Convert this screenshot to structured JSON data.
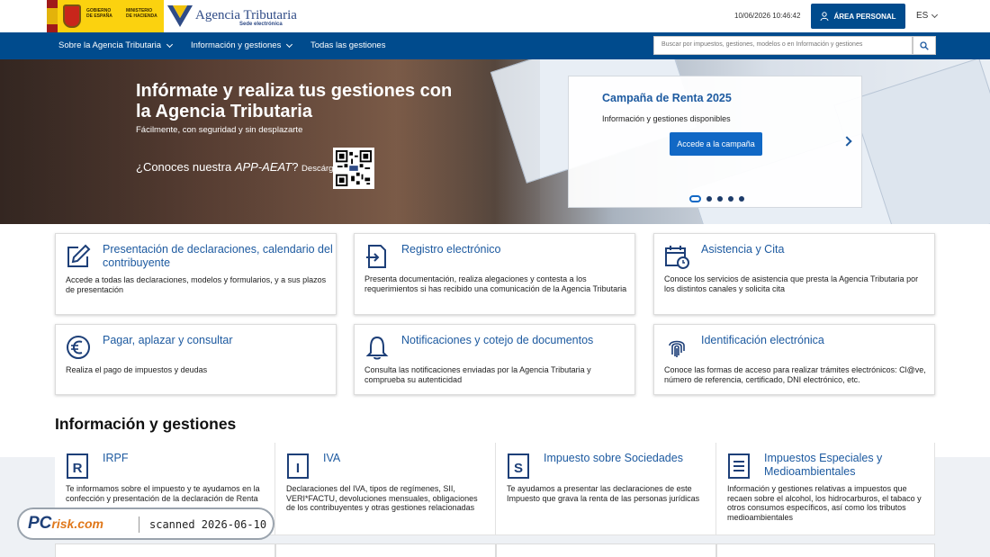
{
  "header": {
    "gov_line1": "GOBIERNO DE ESPAÑA",
    "gov_line2": "MINISTERIO DE HACIENDA",
    "agency_name": "Agencia Tributaria",
    "agency_sub": "Sede electrónica",
    "datetime": "10/06/2026 10:46:42",
    "area_personal": "ÁREA PERSONAL",
    "lang": "ES"
  },
  "nav": {
    "items": [
      "Sobre la Agencia Tributaria",
      "Información y gestiones",
      "Todas las gestiones"
    ],
    "search_placeholder": "Buscar por impuestos, gestiones, modelos o en Información y gestiones"
  },
  "hero": {
    "title": "Infórmate y realiza tus gestiones con la Agencia Tributaria",
    "subtitle": "Fácilmente, con seguridad y sin desplazarte",
    "app_question_pre": "¿Conoces nuestra ",
    "app_name": "APP-AEAT",
    "app_question_post": "?",
    "app_download": "Descárgala",
    "promo_title": "Campaña de Renta 2025",
    "promo_sub": "Información y gestiones disponibles",
    "promo_button": "Accede a la campaña",
    "slides_total": 5,
    "slide_active": 1
  },
  "cards": [
    {
      "title": "Presentación de declaraciones, calendario del contribuyente",
      "desc": "Accede a todas las declaraciones, modelos y formularios, y a sus plazos de presentación",
      "icon": "edit-icon"
    },
    {
      "title": "Registro electrónico",
      "desc": "Presenta documentación, realiza alegaciones y contesta a los requerimientos si has recibido una comunicación de la Agencia Tributaria",
      "icon": "document-arrow-icon"
    },
    {
      "title": "Asistencia y Cita",
      "desc": "Conoce los servicios de asistencia que presta la Agencia Tributaria por los distintos canales y solicita cita",
      "icon": "calendar-clock-icon"
    },
    {
      "title": "Pagar, aplazar y consultar",
      "desc": "Realiza el pago de impuestos y deudas",
      "icon": "euro-icon"
    },
    {
      "title": "Notificaciones y cotejo de documentos",
      "desc": "Consulta las notificaciones enviadas por la Agencia Tributaria y comprueba su autenticidad",
      "icon": "bell-icon"
    },
    {
      "title": "Identificación electrónica",
      "desc": "Conoce las formas de acceso para realizar trámites electrónicos: Cl@ve, número de referencia, certificado, DNI electrónico, etc.",
      "icon": "fingerprint-icon"
    }
  ],
  "info_section": {
    "title": "Información y gestiones",
    "items": [
      {
        "title": "IRPF",
        "desc": "Te informamos sobre el impuesto y te ayudamos en la confección y presentación de la declaración de Renta",
        "letter": "R"
      },
      {
        "title": "IVA",
        "desc": "Declaraciones del IVA, tipos de regímenes, SII, VERI*FACTU, devoluciones mensuales, obligaciones de los contribuyentes y otras gestiones relacionadas",
        "letter": "I"
      },
      {
        "title": "Impuesto sobre Sociedades",
        "desc": "Te ayudamos a presentar las declaraciones de este Impuesto que grava la renta de las personas jurídicas",
        "letter": "S"
      },
      {
        "title": "Impuestos Especiales y Medioambientales",
        "desc": "Información y gestiones relativas a impuestos que recaen sobre el alcohol, los hidrocarburos, el tabaco y otros consumos específicos, así como los tributos medioambientales",
        "letter": "≡"
      }
    ]
  },
  "watermark": {
    "brand": "PC",
    "brand_suffix": "risk.com",
    "text": "scanned 2026-06-10"
  }
}
